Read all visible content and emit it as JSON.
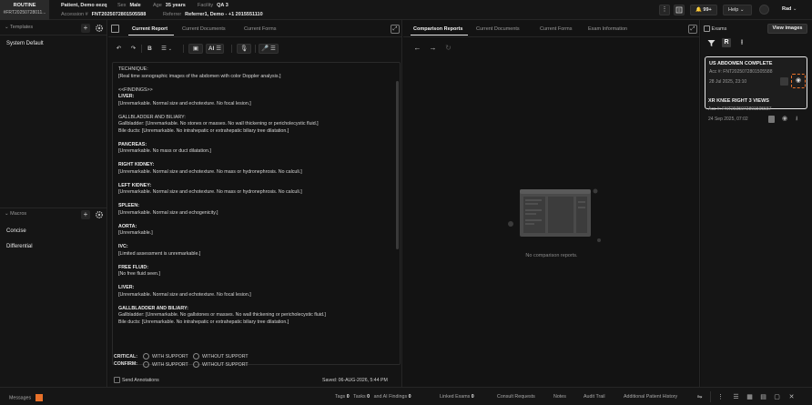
{
  "header": {
    "priority": "ROUTINE",
    "order_id": "#FRT20250728011...",
    "patient_name": "Patient, Demo eezq",
    "sex_label": "Sex",
    "sex": "Male",
    "age_label": "Age",
    "age": "35 years",
    "facility_label": "Facility",
    "facility": "QA 3",
    "accession_label": "Accession #",
    "accession": "FNT2025072801505588",
    "referrer_label": "Referrer",
    "referrer": "Referrer1, Demo - +1 2015551110",
    "notifications": "99+",
    "help": "Help",
    "user": "Rad"
  },
  "left": {
    "templates_title": "Templates",
    "templates": [
      "System Default"
    ],
    "macros_title": "Macros",
    "macros": [
      "Concise",
      "Differential"
    ]
  },
  "editor": {
    "tabs": [
      "Current Report",
      "Current Documents",
      "Current Forms"
    ],
    "active_tab": "Current Report",
    "toolbar": {
      "ai": "AI"
    },
    "report": [
      {
        "t": "TECHNIQUE:",
        "b": false
      },
      {
        "t": "[Real time sonographic images of the abdomen with color Doppler analysis.]",
        "b": false
      },
      {
        "t": "",
        "b": false
      },
      {
        "t": "<<FINDINGS>>",
        "b": false
      },
      {
        "t": "LIVER:",
        "b": true
      },
      {
        "t": "[Unremarkable. Normal size and echotexture. No focal lesion.]",
        "b": false
      },
      {
        "t": "",
        "b": false
      },
      {
        "t": "GALLBLADDER AND BILIARY:",
        "b": false
      },
      {
        "t": "Gallbladder: [Unremarkable. No stones or masses. No wall thickening or pericholecystic fluid.]",
        "b": false
      },
      {
        "t": "Bile ducts: [Unremarkable. No intrahepatic or extrahepatic biliary tree dilatation.]",
        "b": false
      },
      {
        "t": "",
        "b": false
      },
      {
        "t": "PANCREAS:",
        "b": true
      },
      {
        "t": "[Unremarkable. No mass or duct dilatation.]",
        "b": false
      },
      {
        "t": "",
        "b": false
      },
      {
        "t": "RIGHT KIDNEY:",
        "b": true
      },
      {
        "t": "[Unremarkable. Normal size and echotexture. No mass or hydronephrosis. No calculi.]",
        "b": false
      },
      {
        "t": "",
        "b": false
      },
      {
        "t": "LEFT KIDNEY:",
        "b": true
      },
      {
        "t": "[Unremarkable. Normal size and echotexture. No mass or hydronephrosis. No calculi.]",
        "b": false
      },
      {
        "t": "",
        "b": false
      },
      {
        "t": "SPLEEN:",
        "b": true
      },
      {
        "t": "[Unremarkable. Normal size and echogenicity.]",
        "b": false
      },
      {
        "t": "",
        "b": false
      },
      {
        "t": "AORTA:",
        "b": true
      },
      {
        "t": "[Unremarkable.]",
        "b": false
      },
      {
        "t": "",
        "b": false
      },
      {
        "t": "IVC:",
        "b": true
      },
      {
        "t": "[Limited assessment is unremarkable.]",
        "b": false
      },
      {
        "t": "",
        "b": false
      },
      {
        "t": "FREE FLUID:",
        "b": true
      },
      {
        "t": "[No free fluid seen.]",
        "b": false
      },
      {
        "t": "",
        "b": false
      },
      {
        "t": "LIVER:",
        "b": true
      },
      {
        "t": "[Unremarkable. Normal size and echotexture. No focal lesion.]",
        "b": false
      },
      {
        "t": "",
        "b": false
      },
      {
        "t": "GALLBLADDER AND BILIARY:",
        "b": true
      },
      {
        "t": "Gallbladder: [Unremarkable. No gallstones or masses. No wall thickening or pericholecystic fluid.]",
        "b": false
      },
      {
        "t": "Bile ducts: [Unremarkable. No intrahepatic or extrahepatic biliary tree dilatation.]",
        "b": false
      }
    ],
    "critical_label": "CRITICAL:",
    "confirm_label": "CONFIRM:",
    "with_support": "WITH SUPPORT",
    "without_support": "WITHOUT SUPPORT",
    "send_annotations": "Send Annotations",
    "saved": "Saved: 06-AUG-2026, 5:44 PM"
  },
  "compare": {
    "tabs": [
      "Comparison Reports",
      "Current Documents",
      "Current Forms",
      "Exam Information"
    ],
    "active_tab": "Comparison Reports",
    "empty_text": "No comparison reports."
  },
  "exams": {
    "title": "Exams",
    "view_images": "View images",
    "list": [
      {
        "title": "US ABDOMEN COMPLETE",
        "acc": "Acc #: FNT2025072801505588",
        "date": "28 Jul 2025, 23:10"
      },
      {
        "title": "XR KNEE RIGHT 3 VIEWS",
        "acc": "Acc #: FNT2025072801505587",
        "date": "24 Sep 2025, 07:02"
      }
    ]
  },
  "footer": {
    "messages": "Messages",
    "tags_label": "Tags",
    "tags": "0",
    "tasks_label": "Tasks",
    "tasks": "0",
    "ai_label": "and AI Findings",
    "ai": "0",
    "linked_label": "Linked Exams",
    "linked": "0",
    "consult": "Consult Requests",
    "notes": "Notes",
    "audit": "Audit Trail",
    "history": "Additional Patient History"
  },
  "colors": {
    "accent": "#e8712a",
    "bg": "#111111",
    "panel": "#151515"
  }
}
